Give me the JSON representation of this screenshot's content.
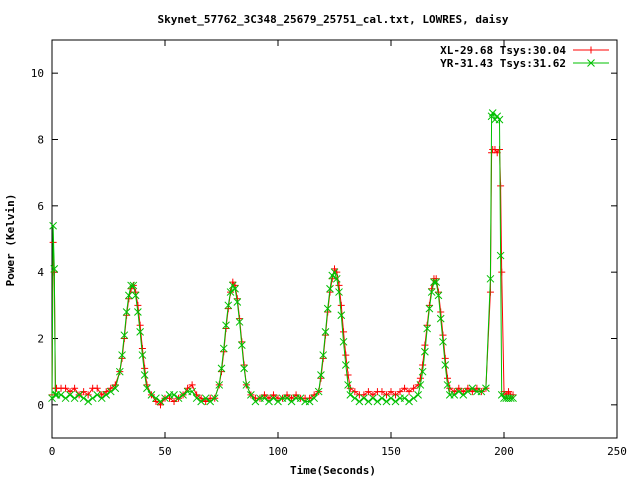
{
  "chart_data": {
    "type": "line",
    "title": "Skynet_57762_3C348_25679_25751_cal.txt, LOWRES, daisy",
    "xlabel": "Time(Seconds)",
    "ylabel": "Power (Kelvin)",
    "xlim": [
      0,
      250
    ],
    "ylim": [
      -1,
      11
    ],
    "xticks": [
      0,
      50,
      100,
      150,
      200,
      250
    ],
    "yticks": [
      0,
      2,
      4,
      6,
      8,
      10
    ],
    "grid": false,
    "legend_position": "top-right",
    "series": [
      {
        "name": "XL-29.68 Tsys:30.04",
        "color": "#ff0000",
        "marker": "plus",
        "x": [
          0.0,
          0.5,
          1.0,
          1.5,
          2,
          4,
          6,
          8,
          10,
          12,
          14,
          16,
          18,
          20,
          22,
          24,
          26,
          28,
          30,
          31,
          32,
          33,
          34,
          35,
          36,
          37,
          38,
          39,
          40,
          41,
          42,
          44,
          46,
          48,
          50,
          52,
          54,
          56,
          58,
          60,
          62,
          64,
          66,
          68,
          70,
          72,
          74,
          75,
          76,
          77,
          78,
          79,
          80,
          81,
          82,
          83,
          84,
          85,
          86,
          88,
          90,
          92,
          94,
          96,
          98,
          100,
          102,
          104,
          106,
          108,
          110,
          112,
          114,
          116,
          118,
          119,
          120,
          121,
          122,
          123,
          124,
          125,
          126,
          127,
          128,
          129,
          130,
          131,
          132,
          134,
          136,
          138,
          140,
          142,
          144,
          146,
          148,
          150,
          152,
          154,
          156,
          158,
          160,
          162,
          163,
          164,
          165,
          166,
          167,
          168,
          169,
          170,
          171,
          172,
          173,
          174,
          175,
          176,
          178,
          180,
          182,
          184,
          186,
          188,
          190,
          192,
          194,
          194.5,
          195,
          196,
          197,
          198,
          198.5,
          199,
          200,
          201,
          202,
          203,
          204
        ],
        "y": [
          0.3,
          4.9,
          4.0,
          0.5,
          0.5,
          0.5,
          0.5,
          0.4,
          0.5,
          0.3,
          0.4,
          0.3,
          0.5,
          0.5,
          0.3,
          0.4,
          0.5,
          0.6,
          1.0,
          1.4,
          2.0,
          2.7,
          3.2,
          3.5,
          3.6,
          3.4,
          3.0,
          2.4,
          1.7,
          1.1,
          0.6,
          0.3,
          0.1,
          0.0,
          0.2,
          0.2,
          0.1,
          0.2,
          0.3,
          0.5,
          0.6,
          0.3,
          0.2,
          0.1,
          0.2,
          0.2,
          0.6,
          1.0,
          1.6,
          2.3,
          2.9,
          3.4,
          3.7,
          3.6,
          3.2,
          2.6,
          1.9,
          1.2,
          0.6,
          0.3,
          0.2,
          0.2,
          0.3,
          0.2,
          0.3,
          0.2,
          0.2,
          0.3,
          0.2,
          0.3,
          0.2,
          0.2,
          0.2,
          0.3,
          0.4,
          0.8,
          1.4,
          2.1,
          2.8,
          3.4,
          3.8,
          4.1,
          4.0,
          3.6,
          3.0,
          2.2,
          1.5,
          0.9,
          0.5,
          0.4,
          0.3,
          0.3,
          0.4,
          0.3,
          0.4,
          0.4,
          0.3,
          0.4,
          0.3,
          0.4,
          0.5,
          0.4,
          0.5,
          0.6,
          0.8,
          1.2,
          1.8,
          2.4,
          3.0,
          3.5,
          3.8,
          3.8,
          3.4,
          2.8,
          2.1,
          1.4,
          0.8,
          0.5,
          0.4,
          0.5,
          0.4,
          0.5,
          0.4,
          0.5,
          0.4,
          0.5,
          3.4,
          7.6,
          7.7,
          7.7,
          7.6,
          7.7,
          6.6,
          4.0,
          0.4,
          0.3,
          0.4,
          0.3,
          0.3
        ]
      },
      {
        "name": "YR-31.43 Tsys:31.62",
        "color": "#00c000",
        "marker": "cross",
        "x": [
          0.0,
          0.5,
          1.0,
          1.5,
          2,
          4,
          6,
          8,
          10,
          12,
          14,
          16,
          18,
          20,
          22,
          24,
          26,
          28,
          30,
          31,
          32,
          33,
          34,
          35,
          36,
          37,
          38,
          39,
          40,
          41,
          42,
          44,
          46,
          48,
          50,
          52,
          54,
          56,
          58,
          60,
          62,
          64,
          66,
          68,
          70,
          72,
          74,
          75,
          76,
          77,
          78,
          79,
          80,
          81,
          82,
          83,
          84,
          85,
          86,
          88,
          90,
          92,
          94,
          96,
          98,
          100,
          102,
          104,
          106,
          108,
          110,
          112,
          114,
          116,
          118,
          119,
          120,
          121,
          122,
          123,
          124,
          125,
          126,
          127,
          128,
          129,
          130,
          131,
          132,
          134,
          136,
          138,
          140,
          142,
          144,
          146,
          148,
          150,
          152,
          154,
          156,
          158,
          160,
          162,
          163,
          164,
          165,
          166,
          167,
          168,
          169,
          170,
          171,
          172,
          173,
          174,
          175,
          176,
          178,
          180,
          182,
          184,
          186,
          188,
          190,
          192,
          194,
          194.5,
          195,
          196,
          197,
          198,
          198.5,
          199,
          200,
          201,
          202,
          203,
          204
        ],
        "y": [
          0.2,
          5.4,
          4.1,
          0.3,
          0.3,
          0.3,
          0.2,
          0.3,
          0.2,
          0.3,
          0.2,
          0.1,
          0.2,
          0.3,
          0.2,
          0.3,
          0.4,
          0.5,
          1.0,
          1.5,
          2.1,
          2.8,
          3.3,
          3.6,
          3.6,
          3.3,
          2.8,
          2.2,
          1.5,
          0.9,
          0.5,
          0.3,
          0.2,
          0.1,
          0.2,
          0.3,
          0.3,
          0.2,
          0.3,
          0.4,
          0.4,
          0.2,
          0.1,
          0.2,
          0.1,
          0.2,
          0.6,
          1.1,
          1.7,
          2.4,
          3.0,
          3.4,
          3.6,
          3.5,
          3.1,
          2.5,
          1.8,
          1.1,
          0.6,
          0.3,
          0.1,
          0.2,
          0.2,
          0.1,
          0.2,
          0.1,
          0.2,
          0.2,
          0.1,
          0.2,
          0.2,
          0.1,
          0.1,
          0.2,
          0.4,
          0.9,
          1.5,
          2.2,
          2.9,
          3.5,
          3.9,
          4.0,
          3.8,
          3.4,
          2.7,
          1.9,
          1.2,
          0.6,
          0.3,
          0.2,
          0.1,
          0.2,
          0.1,
          0.2,
          0.1,
          0.2,
          0.1,
          0.2,
          0.1,
          0.2,
          0.2,
          0.1,
          0.2,
          0.3,
          0.6,
          1.0,
          1.6,
          2.3,
          2.9,
          3.4,
          3.7,
          3.7,
          3.3,
          2.6,
          1.9,
          1.2,
          0.6,
          0.3,
          0.3,
          0.4,
          0.3,
          0.4,
          0.5,
          0.4,
          0.4,
          0.5,
          3.8,
          8.7,
          8.8,
          8.6,
          8.7,
          8.6,
          4.5,
          0.3,
          0.2,
          0.2,
          0.2,
          0.2,
          0.2
        ]
      }
    ]
  }
}
